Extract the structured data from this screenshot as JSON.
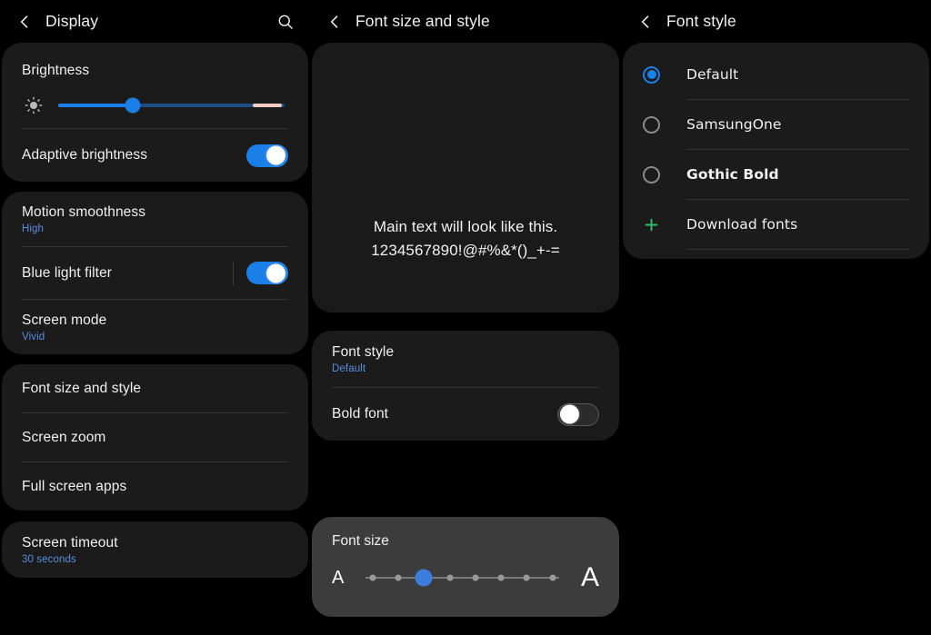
{
  "theme": {
    "background": "#000000",
    "card_bg": "#1b1b1b",
    "card_bg_light": "#3c3c3c",
    "accent_blue": "#1a7fe8",
    "sub_text_blue": "#5a8de0",
    "text_primary": "#f0f0f0",
    "green_plus": "#2dbd6e",
    "warm_slider": "#f3c9c4"
  },
  "panels": {
    "display": {
      "header": {
        "title": "Display",
        "back_icon": "chevron-left-icon",
        "search_icon": "search-icon"
      },
      "brightness": {
        "title": "Brightness",
        "sun_icon": "brightness-sun-icon",
        "value_percent": 33,
        "warm_start_percent": 86,
        "warm_end_percent": 99
      },
      "adaptive_brightness": {
        "title": "Adaptive brightness",
        "toggle_on": true
      },
      "motion_smoothness": {
        "title": "Motion smoothness",
        "value": "High"
      },
      "blue_light_filter": {
        "title": "Blue light filter",
        "toggle_on": true
      },
      "screen_mode": {
        "title": "Screen mode",
        "value": "Vivid"
      },
      "font_size_and_style": {
        "title": "Font size and style"
      },
      "screen_zoom": {
        "title": "Screen zoom"
      },
      "full_screen_apps": {
        "title": "Full screen apps"
      },
      "screen_timeout": {
        "title": "Screen timeout",
        "value": "30 seconds"
      }
    },
    "font_size_and_style": {
      "header": {
        "title": "Font size and style",
        "back_icon": "chevron-left-icon"
      },
      "preview": {
        "line1": "Main text will look like this.",
        "line2": "1234567890!@#%&*()_+-="
      },
      "font_style": {
        "title": "Font style",
        "value": "Default"
      },
      "bold_font": {
        "title": "Bold font",
        "toggle_on": false
      },
      "font_size": {
        "title": "Font size",
        "small_label": "A",
        "large_label": "A",
        "steps": 8,
        "selected_index": 2
      }
    },
    "font_style": {
      "header": {
        "title": "Font style",
        "back_icon": "chevron-left-icon"
      },
      "options": [
        {
          "label": "Default",
          "selected": true,
          "bold": false,
          "icon": "radio-icon"
        },
        {
          "label": "SamsungOne",
          "selected": false,
          "bold": false,
          "icon": "radio-icon"
        },
        {
          "label": "Gothic Bold",
          "selected": false,
          "bold": true,
          "icon": "radio-icon"
        },
        {
          "label": "Download fonts",
          "selected": false,
          "bold": false,
          "icon": "plus-icon"
        }
      ]
    }
  }
}
